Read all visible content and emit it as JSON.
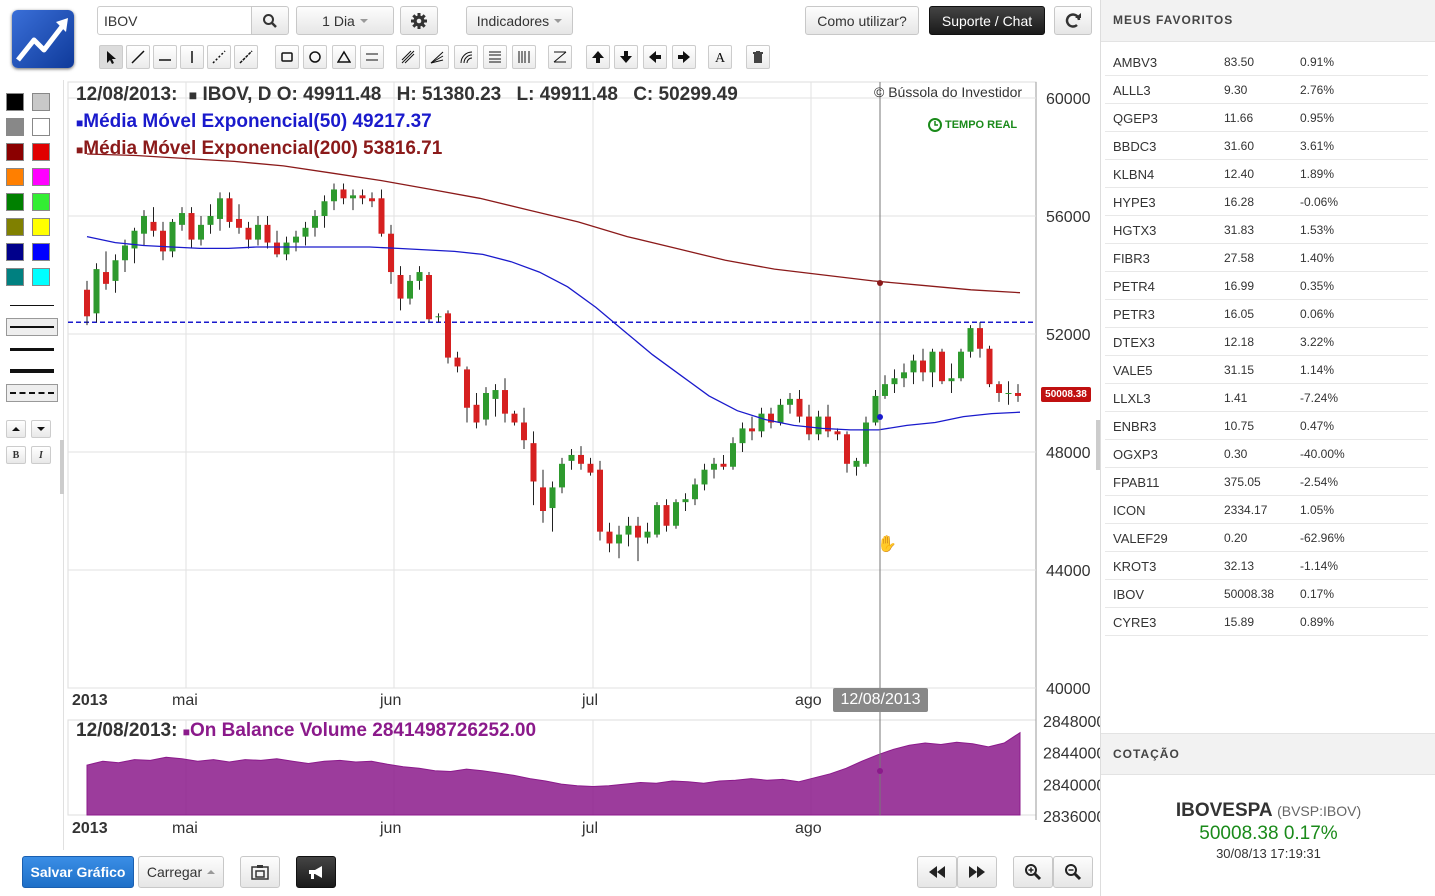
{
  "toolbar": {
    "symbol_value": "IBOV",
    "period_label": "1 Dia",
    "indicators_label": "Indicadores",
    "howto_label": "Como utilizar?",
    "support_label": "Suporte / Chat"
  },
  "chart": {
    "date": "12/08/2013:",
    "symbol": "IBOV, D",
    "o_label": "O:",
    "o_value": "49911.48",
    "h_label": "H:",
    "h_value": "51380.23",
    "l_label": "L:",
    "l_value": "49911.48",
    "c_label": "C:",
    "c_value": "50299.49",
    "credit": "© Bússola do Investidor",
    "realtime": "TEMPO REAL",
    "ema50": "Média Móvel Exponencial(50) 49217.37",
    "ema200": "Média Móvel Exponencial(200) 53816.71",
    "price_tag": "50008.38",
    "crosshair_date": "12/08/2013",
    "obv_date": "12/08/2013:",
    "obv_label": "On Balance Volume 2841498726252.00",
    "colors": {
      "up": "#2e9a2e",
      "down": "#d62020",
      "ema50": "#1a1acc",
      "ema200": "#8b1a1a",
      "obv": "#8b1a8b",
      "dash": "#1a1acc"
    }
  },
  "chart_data": {
    "type": "candlestick",
    "y_ticks": [
      "60000",
      "56000",
      "52000",
      "48000",
      "44000",
      "40000"
    ],
    "ylim": [
      40000,
      60000
    ],
    "x_labels": [
      "2013",
      "mai",
      "jun",
      "jul",
      "ago"
    ],
    "obv_ticks": [
      "2848000",
      "2844000",
      "2840000",
      "2836000"
    ],
    "obv_ylim": [
      2836000,
      2848000
    ],
    "hline": 52400,
    "ohlc": [
      [
        53500,
        53800,
        52300,
        52600
      ],
      [
        52700,
        54400,
        52400,
        54200
      ],
      [
        54100,
        54800,
        53500,
        53700
      ],
      [
        53800,
        54700,
        53400,
        54500
      ],
      [
        54500,
        55200,
        54100,
        55000
      ],
      [
        54900,
        55600,
        54400,
        55500
      ],
      [
        55400,
        56200,
        55000,
        56000
      ],
      [
        55800,
        56300,
        55300,
        55500
      ],
      [
        55500,
        55800,
        54500,
        54800
      ],
      [
        54800,
        55900,
        54600,
        55800
      ],
      [
        55700,
        56300,
        55500,
        56100
      ],
      [
        56100,
        56300,
        54900,
        55200
      ],
      [
        55200,
        56000,
        55000,
        55700
      ],
      [
        55700,
        56400,
        55400,
        56000
      ],
      [
        55900,
        56800,
        55500,
        56600
      ],
      [
        56600,
        56800,
        55600,
        55800
      ],
      [
        55900,
        56400,
        55400,
        55600
      ],
      [
        55600,
        55800,
        54900,
        55200
      ],
      [
        55200,
        56000,
        55000,
        55700
      ],
      [
        55700,
        56000,
        54900,
        55100
      ],
      [
        55100,
        55500,
        54600,
        54700
      ],
      [
        54700,
        55300,
        54500,
        55100
      ],
      [
        55100,
        55500,
        54800,
        55300
      ],
      [
        55300,
        55800,
        55000,
        55600
      ],
      [
        55600,
        56200,
        55300,
        56000
      ],
      [
        56000,
        56700,
        55600,
        56500
      ],
      [
        56500,
        57100,
        56200,
        56900
      ],
      [
        56900,
        57100,
        56400,
        56600
      ],
      [
        56600,
        56900,
        56200,
        56700
      ],
      [
        56700,
        56900,
        56400,
        56600
      ],
      [
        56600,
        56800,
        56300,
        56500
      ],
      [
        56600,
        56900,
        55300,
        55400
      ],
      [
        55400,
        55700,
        53700,
        54100
      ],
      [
        54000,
        54300,
        52800,
        53200
      ],
      [
        53200,
        54000,
        53000,
        53800
      ],
      [
        53800,
        54300,
        53500,
        54100
      ],
      [
        54000,
        54100,
        52400,
        52500
      ],
      [
        52600,
        52700,
        52400,
        52600
      ],
      [
        52700,
        52800,
        51000,
        51200
      ],
      [
        51200,
        51400,
        50700,
        50900
      ],
      [
        50800,
        50900,
        49000,
        49500
      ],
      [
        49600,
        50000,
        48800,
        49000
      ],
      [
        49100,
        50200,
        48900,
        50000
      ],
      [
        49800,
        50300,
        49200,
        50100
      ],
      [
        50100,
        50500,
        49000,
        49300
      ],
      [
        49300,
        49400,
        48900,
        49000
      ],
      [
        49000,
        49500,
        48100,
        48400
      ],
      [
        48300,
        48700,
        46200,
        47000
      ],
      [
        46800,
        47400,
        45600,
        46000
      ],
      [
        46100,
        47000,
        45300,
        46800
      ],
      [
        46800,
        47800,
        46600,
        47600
      ],
      [
        47700,
        48100,
        47400,
        47900
      ],
      [
        47900,
        48200,
        47400,
        47600
      ],
      [
        47600,
        47800,
        47200,
        47300
      ],
      [
        47400,
        47700,
        45000,
        45300
      ],
      [
        45300,
        45600,
        44600,
        44900
      ],
      [
        44900,
        45500,
        44400,
        45200
      ],
      [
        45200,
        45800,
        44800,
        45500
      ],
      [
        45500,
        45800,
        44300,
        45100
      ],
      [
        45100,
        45600,
        44900,
        45300
      ],
      [
        45200,
        46300,
        45100,
        46200
      ],
      [
        46200,
        46400,
        45300,
        45500
      ],
      [
        45500,
        46400,
        45400,
        46300
      ],
      [
        46300,
        46600,
        46000,
        46400
      ],
      [
        46400,
        47100,
        46200,
        46900
      ],
      [
        46900,
        47600,
        46700,
        47400
      ],
      [
        47400,
        47800,
        47100,
        47600
      ],
      [
        47600,
        47900,
        47400,
        47500
      ],
      [
        47500,
        48500,
        47400,
        48300
      ],
      [
        48300,
        49000,
        48000,
        48800
      ],
      [
        48800,
        49200,
        48400,
        48700
      ],
      [
        48700,
        49500,
        48500,
        49300
      ],
      [
        49300,
        49500,
        48800,
        49000
      ],
      [
        49000,
        49800,
        48900,
        49600
      ],
      [
        49600,
        50000,
        49300,
        49800
      ],
      [
        49800,
        50100,
        49000,
        49200
      ],
      [
        49200,
        49600,
        48400,
        48600
      ],
      [
        48600,
        49400,
        48400,
        49200
      ],
      [
        49200,
        49600,
        48500,
        48700
      ],
      [
        48700,
        48800,
        48400,
        48600
      ],
      [
        48600,
        48700,
        47300,
        47600
      ],
      [
        47500,
        47800,
        47200,
        47700
      ],
      [
        47600,
        49200,
        47500,
        49000
      ],
      [
        49000,
        50100,
        48900,
        49900
      ],
      [
        49900,
        50600,
        49800,
        50300
      ],
      [
        50300,
        50800,
        50000,
        50500
      ],
      [
        50500,
        51000,
        50200,
        50700
      ],
      [
        50700,
        51300,
        50300,
        51100
      ],
      [
        51100,
        51500,
        50400,
        50700
      ],
      [
        50700,
        51500,
        50200,
        51400
      ],
      [
        51400,
        51500,
        50300,
        50400
      ],
      [
        50400,
        51000,
        50000,
        50500
      ],
      [
        50500,
        51500,
        50400,
        51400
      ],
      [
        51400,
        52300,
        51200,
        52200
      ],
      [
        52200,
        52400,
        51200,
        51500
      ],
      [
        51500,
        51600,
        50200,
        50300
      ],
      [
        50300,
        50400,
        49700,
        50000
      ],
      [
        50000,
        50400,
        49600,
        50000
      ],
      [
        50000,
        50300,
        49700,
        49900
      ]
    ],
    "ema50": [
      55300,
      55100,
      55000,
      54950,
      54900,
      54900,
      54950,
      54950,
      54950,
      54950,
      54950,
      54900,
      54850,
      54800,
      54700,
      54450,
      54100,
      53600,
      52900,
      52100,
      51300,
      50600,
      49900,
      49400,
      49100,
      48900,
      48800,
      48750,
      48750,
      48900,
      49000,
      49200,
      49300,
      49350
    ],
    "ema200": [
      58100,
      58050,
      57950,
      57850,
      57700,
      57450,
      57200,
      56900,
      56600,
      56200,
      55800,
      55300,
      54900,
      54500,
      54200,
      54000,
      53800,
      53650,
      53500,
      53400
    ],
    "obv": [
      2842300,
      2842800,
      2842600,
      2843000,
      2842900,
      2843300,
      2843100,
      2842800,
      2843000,
      2842700,
      2843000,
      2842900,
      2843100,
      2842800,
      2842500,
      2842800,
      2842900,
      2842700,
      2842800,
      2842400,
      2842100,
      2841900,
      2841600,
      2841500,
      2841800,
      2841600,
      2841300,
      2841000,
      2840600,
      2840300,
      2839900,
      2839700,
      2839600,
      2839700,
      2839900,
      2840100,
      2840000,
      2840300,
      2840200,
      2840000,
      2840300,
      2840400,
      2840600,
      2840400,
      2840500,
      2840200,
      2840700,
      2841200,
      2841900,
      2842800,
      2843600,
      2844300,
      2844800,
      2845100,
      2844900,
      2845200,
      2845000,
      2844600,
      2845100,
      2846400
    ]
  },
  "left": {
    "colors": [
      "#000000",
      "#c8c8c8",
      "#888888",
      "#ffffff",
      "#8b0000",
      "#e00000",
      "#ff7f00",
      "#ff00ff",
      "#008000",
      "#33ee33",
      "#808000",
      "#ffff00",
      "#00008b",
      "#0000ff",
      "#008080",
      "#00ffff"
    ]
  },
  "right": {
    "favorites_title": "MEUS FAVORITOS",
    "favorites": [
      {
        "ticker": "AMBV3",
        "price": "83.50",
        "change": "0.91%"
      },
      {
        "ticker": "ALLL3",
        "price": "9.30",
        "change": "2.76%"
      },
      {
        "ticker": "QGEP3",
        "price": "11.66",
        "change": "0.95%"
      },
      {
        "ticker": "BBDC3",
        "price": "31.60",
        "change": "3.61%"
      },
      {
        "ticker": "KLBN4",
        "price": "12.40",
        "change": "1.89%"
      },
      {
        "ticker": "HYPE3",
        "price": "16.28",
        "change": "-0.06%"
      },
      {
        "ticker": "HGTX3",
        "price": "31.83",
        "change": "1.53%"
      },
      {
        "ticker": "FIBR3",
        "price": "27.58",
        "change": "1.40%"
      },
      {
        "ticker": "PETR4",
        "price": "16.99",
        "change": "0.35%"
      },
      {
        "ticker": "PETR3",
        "price": "16.05",
        "change": "0.06%"
      },
      {
        "ticker": "DTEX3",
        "price": "12.18",
        "change": "3.22%"
      },
      {
        "ticker": "VALE5",
        "price": "31.15",
        "change": "1.14%"
      },
      {
        "ticker": "LLXL3",
        "price": "1.41",
        "change": "-7.24%"
      },
      {
        "ticker": "ENBR3",
        "price": "10.75",
        "change": "0.47%"
      },
      {
        "ticker": "OGXP3",
        "price": "0.30",
        "change": "-40.00%"
      },
      {
        "ticker": "FPAB11",
        "price": "375.05",
        "change": "-2.54%"
      },
      {
        "ticker": "ICON",
        "price": "2334.17",
        "change": "1.05%"
      },
      {
        "ticker": "VALEF29",
        "price": "0.20",
        "change": "-62.96%"
      },
      {
        "ticker": "KROT3",
        "price": "32.13",
        "change": "-1.14%"
      },
      {
        "ticker": "IBOV",
        "price": "50008.38",
        "change": "0.17%"
      },
      {
        "ticker": "CYRE3",
        "price": "15.89",
        "change": "0.89%"
      }
    ],
    "quote_title": "COTAÇÃO",
    "quote_name": "IBOVESPA",
    "quote_code": "(BVSP:IBOV)",
    "quote_value": "50008.38 0.17%",
    "quote_time": "30/08/13 17:19:31"
  },
  "bottom": {
    "save_label": "Salvar Gráfico",
    "load_label": "Carregar"
  }
}
